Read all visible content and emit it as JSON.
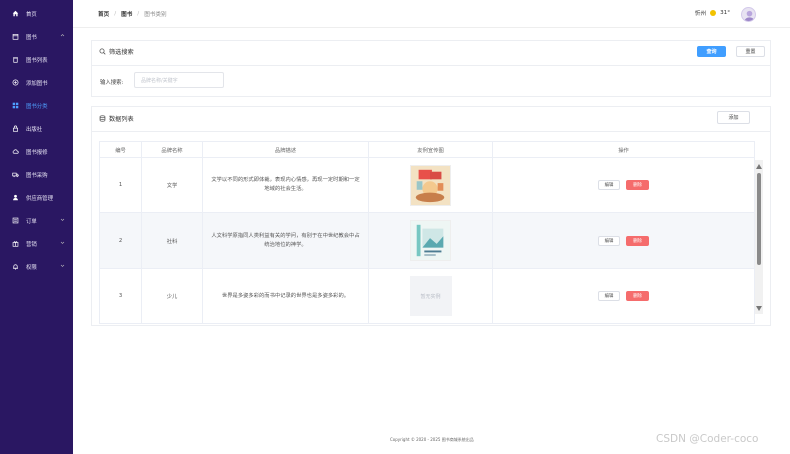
{
  "sidebar": {
    "items": [
      {
        "label": "首页",
        "icon": "home-icon"
      },
      {
        "label": "图书",
        "icon": "calendar-icon",
        "expandable": true
      },
      {
        "label": "图书列表",
        "icon": "trash-icon"
      },
      {
        "label": "添加图书",
        "icon": "add-circle-icon"
      },
      {
        "label": "图书分类",
        "icon": "grid-icon",
        "active": true
      },
      {
        "label": "出版社",
        "icon": "lock-icon"
      },
      {
        "label": "图书报修",
        "icon": "cloud-icon"
      },
      {
        "label": "图书采购",
        "icon": "truck-icon"
      },
      {
        "label": "供应商管理",
        "icon": "user-icon"
      },
      {
        "label": "订单",
        "icon": "list-icon",
        "expandable": true
      },
      {
        "label": "营销",
        "icon": "gift-icon",
        "expandable": true
      },
      {
        "label": "权限",
        "icon": "bell-icon",
        "expandable": true
      }
    ]
  },
  "header": {
    "breadcrumb": [
      "首页",
      "图书",
      "图书类别"
    ],
    "city": "忻州",
    "temperature": "31°"
  },
  "filter": {
    "title": "筛选搜索",
    "search_button": "查询",
    "reset_button": "重置",
    "input_label": "输入搜索:",
    "input_placeholder": "品牌名称/关键字"
  },
  "list": {
    "title": "数据列表",
    "add_button": "添加",
    "columns": [
      "编号",
      "品牌名称",
      "品牌描述",
      "友例宣传图",
      "操作"
    ],
    "rows": [
      {
        "id": "1",
        "name": "文学",
        "desc": "文学以不同的形式即体裁，表现内心情感，再现一定时期和一定地域的社会生活。",
        "image": "cover-1",
        "edit": "编辑",
        "delete": "删除"
      },
      {
        "id": "2",
        "name": "社科",
        "desc": "人文科学原指同人类利益有关的学问，有别于在中世纪教会中占统治地位的神学。",
        "image": "cover-2",
        "edit": "编辑",
        "delete": "删除"
      },
      {
        "id": "3",
        "name": "少儿",
        "desc": "世界是多姿多彩的而书中记录的世界也是多姿多彩的。",
        "image": null,
        "no_image_text": "暂无实例",
        "edit": "编辑",
        "delete": "删除"
      }
    ]
  },
  "footer": {
    "text": "Copyright © 2020 - 2025 图书商城系统出品"
  },
  "watermark": {
    "text": "CSDN @Coder-coco"
  },
  "colors": {
    "sidebar": "#2a1762",
    "primary": "#409eff",
    "danger": "#f56c6c",
    "active": "#4fa0ff"
  }
}
